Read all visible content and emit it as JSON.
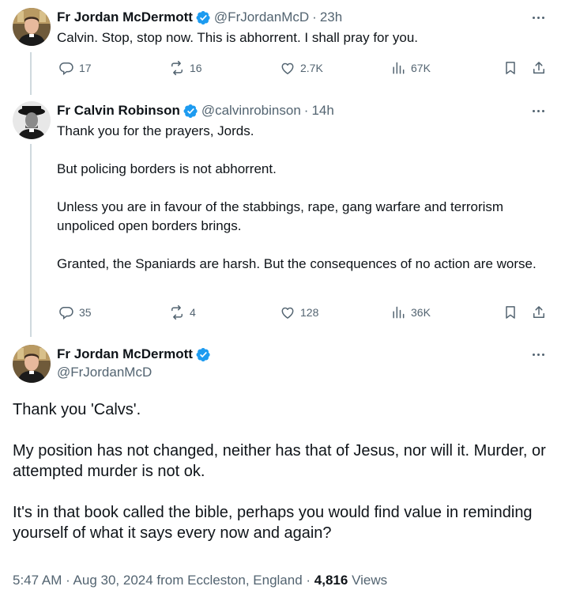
{
  "tweets": [
    {
      "author": "Fr Jordan McDermott",
      "handle": "@FrJordanMcD",
      "separator": "·",
      "time": "23h",
      "text": "Calvin. Stop, stop now. This is abhorrent. I shall pray for you.",
      "replies": "17",
      "reposts": "16",
      "likes": "2.7K",
      "views": "67K"
    },
    {
      "author": "Fr Calvin Robinson",
      "handle": "@calvinrobinson",
      "separator": "·",
      "time": "14h",
      "paragraphs": [
        "Thank you for the prayers, Jords.",
        "But policing borders is not abhorrent.",
        "Unless you are in favour of the stabbings, rape, gang warfare and terrorism unpoliced open borders brings.",
        "Granted, the Spaniards are harsh. But the consequences of no action are worse."
      ],
      "replies": "35",
      "reposts": "4",
      "likes": "128",
      "views": "36K"
    }
  ],
  "main_tweet": {
    "author": "Fr Jordan McDermott",
    "handle": "@FrJordanMcD",
    "paragraphs": [
      "Thank you 'Calvs'.",
      "My position has not changed, neither has that of Jesus, nor will it. Murder, or attempted murder is not ok.",
      "It's in that book called the bible, perhaps you would find value in reminding yourself of what it says every now and again?"
    ],
    "timestamp": "5:47 AM · Aug 30, 2024 from Eccleston, England ·",
    "view_count": "4,816",
    "views_label": "Views"
  },
  "icons": [
    "verified-badge-icon",
    "more-icon",
    "reply-icon",
    "repost-icon",
    "like-icon",
    "views-icon",
    "bookmark-icon",
    "share-icon"
  ],
  "colors": {
    "verified": "#1d9bf0",
    "secondary_text": "#536471",
    "thread_line": "#cfd9de"
  }
}
